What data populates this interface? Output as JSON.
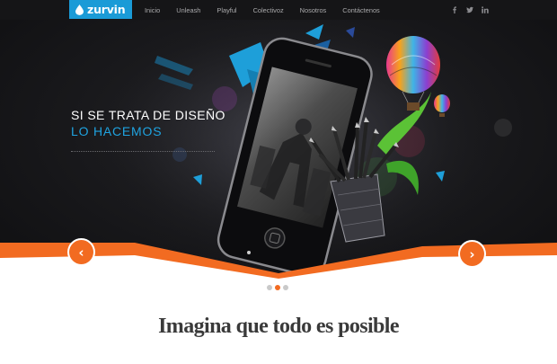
{
  "brand": {
    "name": "zurvin",
    "color": "#1a9bd7"
  },
  "nav": {
    "items": [
      {
        "label": "Inicio"
      },
      {
        "label": "Unleash"
      },
      {
        "label": "Playful"
      },
      {
        "label": "Colectivoz"
      },
      {
        "label": "Nosotros"
      },
      {
        "label": "Contáctenos"
      }
    ]
  },
  "social": [
    {
      "icon": "facebook-icon"
    },
    {
      "icon": "twitter-icon"
    },
    {
      "icon": "linkedin-icon"
    }
  ],
  "hero": {
    "tagline_1": "SI SE TRATA DE DISEÑO",
    "tagline_2": "LO HACEMOS",
    "accent_color": "#1fa3e0",
    "arrow_color": "#f26b21",
    "prev_label": "‹",
    "next_label": "›"
  },
  "slider": {
    "total": 3,
    "active": 2
  },
  "headline": "Imagina que todo es posible"
}
